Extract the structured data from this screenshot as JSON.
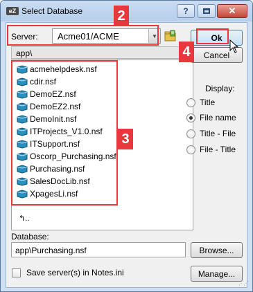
{
  "window": {
    "title": "Select Database",
    "app_icon_text": "eZ",
    "help_label": "?",
    "close_label": "✕"
  },
  "server": {
    "label": "Server:",
    "value": "Acme01/ACME",
    "icon": "server-folder-icon"
  },
  "path": {
    "value": "app\\"
  },
  "files": [
    {
      "name": "acmehelpdesk.nsf"
    },
    {
      "name": "cdir.nsf"
    },
    {
      "name": "DemoEZ.nsf"
    },
    {
      "name": "DemoEZ2.nsf"
    },
    {
      "name": "DemoInit.nsf"
    },
    {
      "name": "ITProjects_V1.0.nsf"
    },
    {
      "name": "ITSupport.nsf"
    },
    {
      "name": "Oscorp_Purchasing.nsf"
    },
    {
      "name": "Purchasing.nsf"
    },
    {
      "name": "SalesDocLib.nsf"
    },
    {
      "name": "XpagesLi.nsf"
    }
  ],
  "up_item": "..",
  "buttons": {
    "ok": "Ok",
    "cancel": "Cancel",
    "browse": "Browse...",
    "manage": "Manage..."
  },
  "display": {
    "label": "Display:",
    "options": [
      {
        "label": "Title",
        "checked": false
      },
      {
        "label": "File name",
        "checked": true
      },
      {
        "label": "Title - File",
        "checked": false
      },
      {
        "label": "File - Title",
        "checked": false
      }
    ]
  },
  "database": {
    "label": "Database:",
    "value": "app\\Purchasing.nsf"
  },
  "save_servers": {
    "label": "Save server(s) in Notes.ini",
    "checked": false
  },
  "annotations": {
    "badges": [
      "2",
      "3",
      "4"
    ],
    "color": "#e8383d"
  },
  "colors": {
    "file_icon": "#2a8fbf",
    "ok_border": "#3c7fb1"
  }
}
